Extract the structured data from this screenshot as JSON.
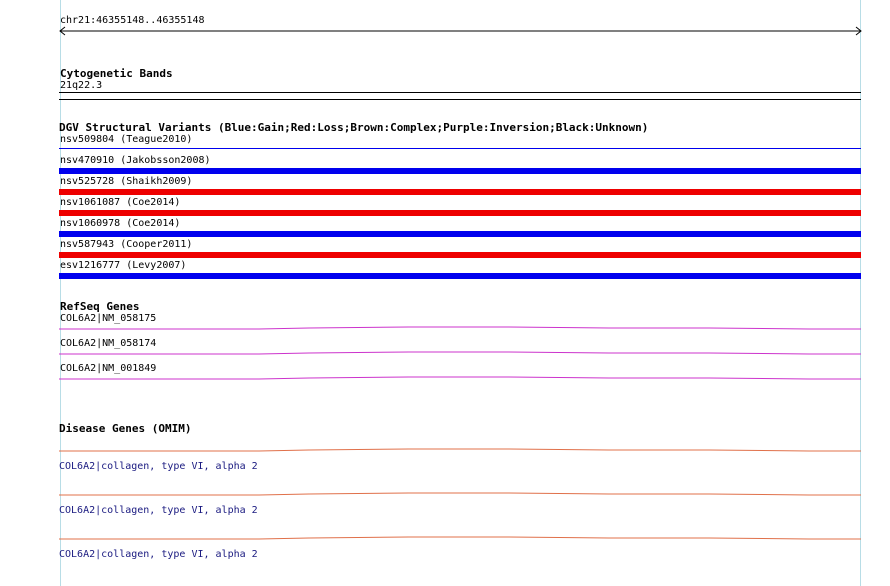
{
  "colors": {
    "gain": "#0000ee",
    "loss": "#ee0000",
    "refseq": "#cc33cc",
    "omim": "#e0704a",
    "guide": "#b8dde6"
  },
  "ruler": {
    "position_label": "chr21:46355148..46355148"
  },
  "cytoband": {
    "title": "Cytogenetic Bands",
    "band": "21q22.3"
  },
  "dgv": {
    "title": "DGV Structural Variants (Blue:Gain;Red:Loss;Brown:Complex;Purple:Inversion;Black:Unknown)",
    "variants": [
      {
        "label": "nsv509804 (Teague2010)",
        "type": "gain"
      },
      {
        "label": "nsv470910 (Jakobsson2008)",
        "type": "gain"
      },
      {
        "label": "nsv525728 (Shaikh2009)",
        "type": "loss"
      },
      {
        "label": "nsv1061087 (Coe2014)",
        "type": "loss"
      },
      {
        "label": "nsv1060978 (Coe2014)",
        "type": "gain"
      },
      {
        "label": "nsv587943 (Cooper2011)",
        "type": "loss"
      },
      {
        "label": "esv1216777 (Levy2007)",
        "type": "gain"
      }
    ]
  },
  "refseq": {
    "title": "RefSeq Genes",
    "genes": [
      {
        "label": "COL6A2|NM_058175"
      },
      {
        "label": "COL6A2|NM_058174"
      },
      {
        "label": "COL6A2|NM_001849"
      }
    ]
  },
  "omim": {
    "title": "Disease Genes (OMIM)",
    "genes": [
      {
        "label": "COL6A2|collagen, type VI, alpha 2"
      },
      {
        "label": "COL6A2|collagen, type VI, alpha 2"
      },
      {
        "label": "COL6A2|collagen, type VI, alpha 2"
      }
    ]
  }
}
